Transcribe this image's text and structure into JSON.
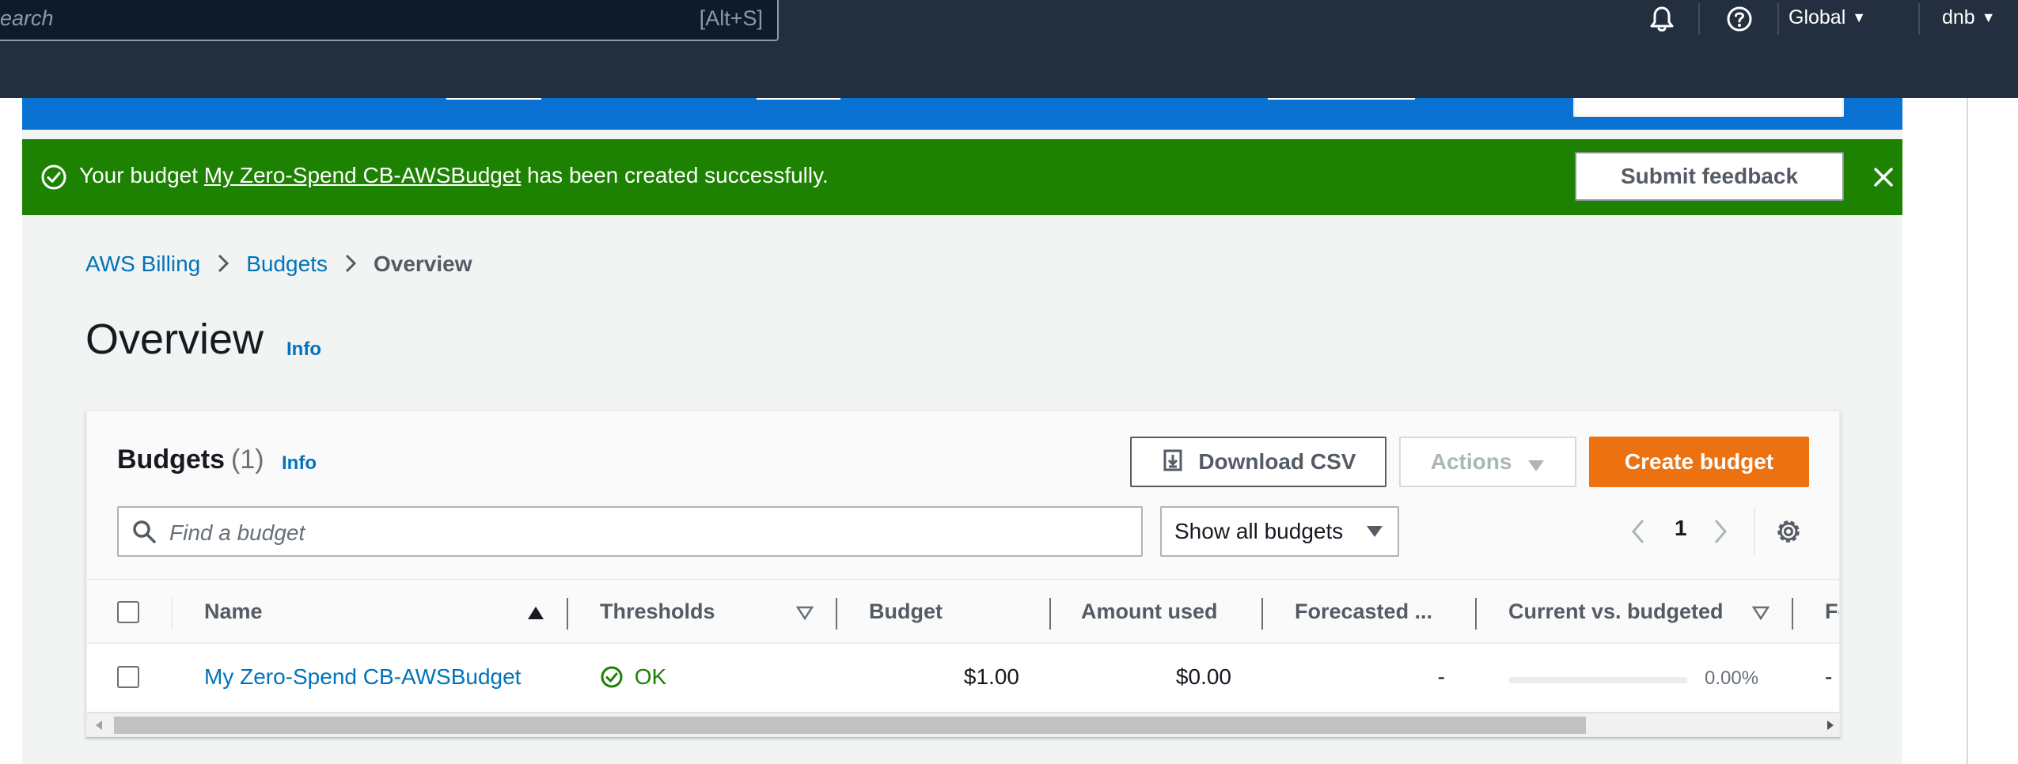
{
  "topnav": {
    "search_placeholder": "earch",
    "search_shortcut": "[Alt+S]",
    "region_label": "Global",
    "account_label": "dnb"
  },
  "flash_success": {
    "prefix": "Your budget ",
    "budget_link": "My Zero-Spend CB-AWSBudget",
    "suffix": " has been created successfully.",
    "feedback_label": "Submit feedback"
  },
  "breadcrumb": {
    "items": [
      "AWS Billing",
      "Budgets",
      "Overview"
    ]
  },
  "page": {
    "title": "Overview",
    "info_label": "Info"
  },
  "budgets": {
    "title": "Budgets",
    "count": "(1)",
    "info_label": "Info",
    "download_label": "Download CSV",
    "actions_label": "Actions",
    "create_label": "Create budget",
    "search_placeholder": "Find a budget",
    "filter_selected": "Show all budgets",
    "page_number": "1",
    "columns": [
      "Name",
      "Thresholds",
      "Budget",
      "Amount used",
      "Forecasted ...",
      "Current vs. budgeted",
      "Fo"
    ],
    "rows": [
      {
        "name": "My Zero-Spend CB-AWSBudget",
        "thresholds": "OK",
        "budget": "$1.00",
        "amount_used": "$0.00",
        "forecasted": "-",
        "current_vs_budgeted": "0.00%",
        "current_vs_budgeted_fraction": 0.0,
        "trailing": "-"
      }
    ]
  },
  "colors": {
    "nav_bg": "#232f3e",
    "info_banner": "#0972d3",
    "success_banner": "#1d8102",
    "primary_button": "#ec7211",
    "link": "#0073bb"
  },
  "icons": {
    "nav": [
      "notification-bell-icon",
      "help-icon"
    ],
    "success": "check-circle-icon",
    "close": "close-icon",
    "download": "download-icon",
    "search": "search-icon",
    "settings": "gear-icon"
  }
}
